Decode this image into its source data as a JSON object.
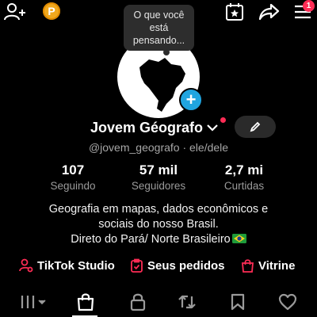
{
  "topbar": {
    "icons": [
      "add-friend-icon",
      "coin-icon",
      "calendar-star-icon",
      "share-icon",
      "menu-icon"
    ],
    "coin_label": "P",
    "menu_badge": "1"
  },
  "profile": {
    "note_bubble": "O que você está pensando...",
    "name": "Jovem Géografo",
    "handle": "@jovem_geografo · ele/dele"
  },
  "stats": [
    {
      "value": "107",
      "label": "Seguindo"
    },
    {
      "value": "57 mil",
      "label": "Seguidores"
    },
    {
      "value": "2,7 mi",
      "label": "Curtidas"
    }
  ],
  "bio": {
    "line1": "Geografia em mapas, dados econômicos e",
    "line2": "sociais do nosso Brasil.",
    "line3": "Direto do Pará/ Norte Brasileiro"
  },
  "links": {
    "studio": "TikTok Studio",
    "orders": "Seus pedidos",
    "showcase": "Vitrine"
  },
  "colors": {
    "background": "#000000",
    "accent_red": "#fe2c55",
    "plus_blue": "#20a5e0",
    "coin": "#f0a81e"
  }
}
